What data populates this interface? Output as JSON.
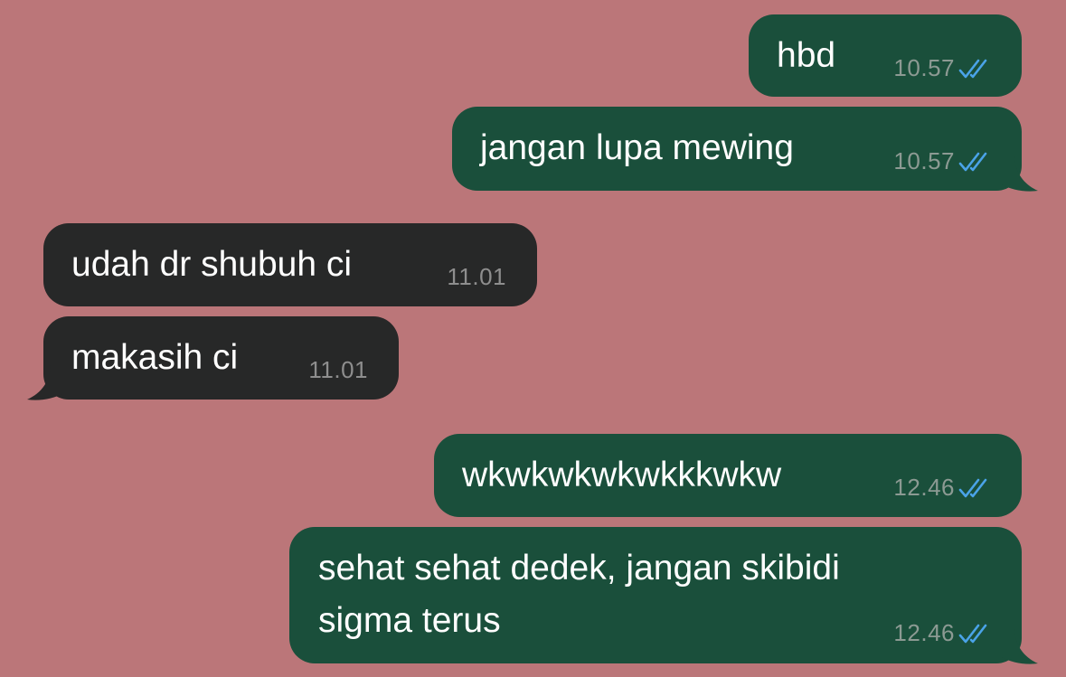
{
  "colors": {
    "background": "#bb7679",
    "outgoing_bubble": "#1a4f3b",
    "incoming_bubble": "#272828",
    "read_check": "#4aa3e8"
  },
  "messages": [
    {
      "direction": "out",
      "text": "hbd",
      "time": "10.57",
      "status": "read-check-icon"
    },
    {
      "direction": "out",
      "text": "jangan lupa mewing",
      "time": "10.57",
      "status": "read-check-icon"
    },
    {
      "direction": "in",
      "text": "udah dr shubuh ci",
      "time": "11.01"
    },
    {
      "direction": "in",
      "text": "makasih ci",
      "time": "11.01"
    },
    {
      "direction": "out",
      "text": "wkwkwkwkwkkkwkw",
      "time": "12.46",
      "status": "read-check-icon"
    },
    {
      "direction": "out",
      "text": "sehat sehat dedek, jangan skibidi\nsigma terus",
      "time": "12.46",
      "status": "read-check-icon"
    }
  ]
}
